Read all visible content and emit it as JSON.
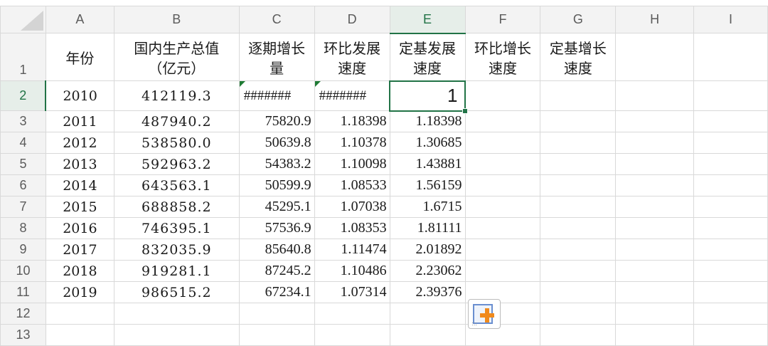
{
  "columns": [
    "A",
    "B",
    "C",
    "D",
    "E",
    "F",
    "G",
    "H",
    "I"
  ],
  "active_column": "E",
  "active_row": "2",
  "header_row": {
    "row_label": "1",
    "cells": [
      "年份",
      "国内生产总值（亿元）",
      "逐期增长量",
      "环比发展速度",
      "定基发展速度",
      "环比增长速度",
      "定基增长速度",
      "",
      ""
    ]
  },
  "row2": {
    "row_label": "2",
    "year": "2010",
    "gdp": "412119.3",
    "c": "#######",
    "d": "#######",
    "e": "1"
  },
  "data_rows": [
    {
      "row_label": "3",
      "year": "2011",
      "gdp": "487940.2",
      "c": "75820.9",
      "d": "1.18398",
      "e": "1.18398"
    },
    {
      "row_label": "4",
      "year": "2012",
      "gdp": "538580.0",
      "c": "50639.8",
      "d": "1.10378",
      "e": "1.30685"
    },
    {
      "row_label": "5",
      "year": "2013",
      "gdp": "592963.2",
      "c": "54383.2",
      "d": "1.10098",
      "e": "1.43881"
    },
    {
      "row_label": "6",
      "year": "2014",
      "gdp": "643563.1",
      "c": "50599.9",
      "d": "1.08533",
      "e": "1.56159"
    },
    {
      "row_label": "7",
      "year": "2015",
      "gdp": "688858.2",
      "c": "45295.1",
      "d": "1.07038",
      "e": "1.6715"
    },
    {
      "row_label": "8",
      "year": "2016",
      "gdp": "746395.1",
      "c": "57536.9",
      "d": "1.08353",
      "e": "1.81111"
    },
    {
      "row_label": "9",
      "year": "2017",
      "gdp": "832035.9",
      "c": "85640.8",
      "d": "1.11474",
      "e": "2.01892"
    },
    {
      "row_label": "10",
      "year": "2018",
      "gdp": "919281.1",
      "c": "87245.2",
      "d": "1.10486",
      "e": "2.23062"
    },
    {
      "row_label": "11",
      "year": "2019",
      "gdp": "986515.2",
      "c": "67234.1",
      "d": "1.07314",
      "e": "2.39376"
    }
  ],
  "empty_rows": [
    "12",
    "13"
  ],
  "paste_options_icon": "paste-options-icon",
  "colors": {
    "selection": "#217346",
    "error_flag": "#1e7b34",
    "paste_plus": "#f08a1c"
  }
}
